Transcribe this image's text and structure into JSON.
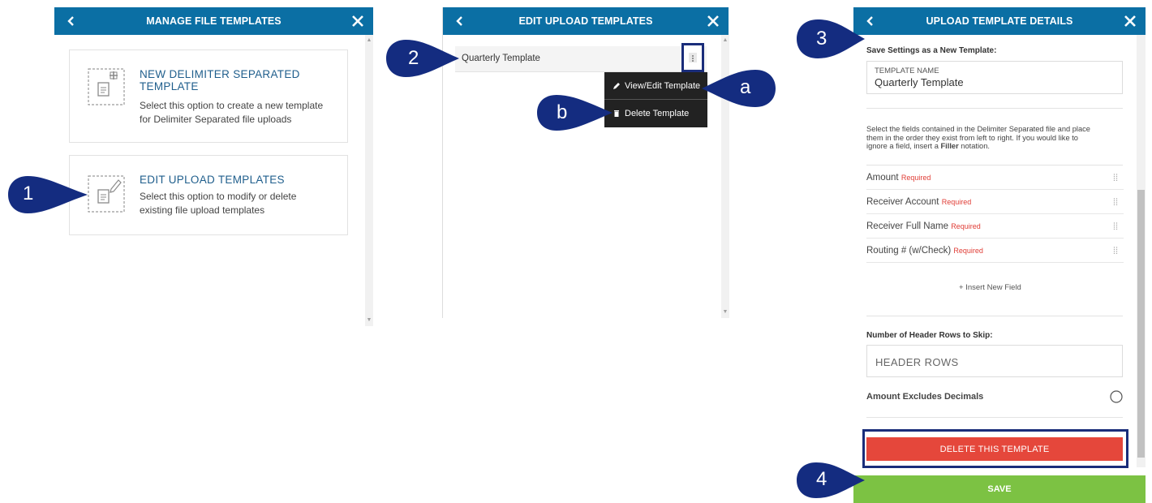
{
  "manage_panel": {
    "title": "MANAGE FILE TEMPLATES",
    "cards": [
      {
        "title_line1": "NEW DELIMITER SEPARATED",
        "title_line2": "TEMPLATE",
        "desc_line1": "Select this option to create a new template",
        "desc_line2": "for Delimiter Separated file uploads",
        "icon": "file-add-icon"
      },
      {
        "title_line1": "EDIT UPLOAD TEMPLATES",
        "desc_line1": "Select this option to modify or delete",
        "desc_line2": "existing file upload templates",
        "icon": "file-edit-icon"
      }
    ]
  },
  "edit_panel": {
    "title": "EDIT UPLOAD TEMPLATES",
    "template_name": "Quarterly Template",
    "menu": {
      "view_edit": "View/Edit Template",
      "delete": "Delete Template"
    }
  },
  "details_panel": {
    "title": "UPLOAD TEMPLATE DETAILS",
    "save_settings_label": "Save Settings as a New Template:",
    "template_name_label": "TEMPLATE NAME",
    "template_name_value": "Quarterly Template",
    "instructions_line1": "Select the fields contained in the Delimiter Separated file and place",
    "instructions_line2": "them in the order they exist from left to right. If you would like to",
    "instructions_line3_pre": "ignore a field, insert a ",
    "instructions_line3_bold": "Filler",
    "instructions_line3_post": " notation.",
    "fields": [
      {
        "name": "Amount",
        "required": "Required"
      },
      {
        "name": "Receiver Account",
        "required": "Required"
      },
      {
        "name": "Receiver Full Name",
        "required": "Required"
      },
      {
        "name": "Routing # (w/Check)",
        "required": "Required"
      }
    ],
    "insert_field": "+ Insert New Field",
    "header_rows_label": "Number of Header Rows to Skip:",
    "header_rows_placeholder": "HEADER ROWS",
    "amount_excludes_decimals": "Amount Excludes Decimals",
    "delete_button": "DELETE THIS TEMPLATE",
    "save_button": "SAVE"
  },
  "callouts": [
    "1",
    "2",
    "3",
    "4",
    "a",
    "b"
  ],
  "colors": {
    "header": "#0b6fa4",
    "callout": "#142c80",
    "delete": "#e5473b",
    "save": "#7cc243",
    "highlight_frame": "#1a2d7a"
  }
}
